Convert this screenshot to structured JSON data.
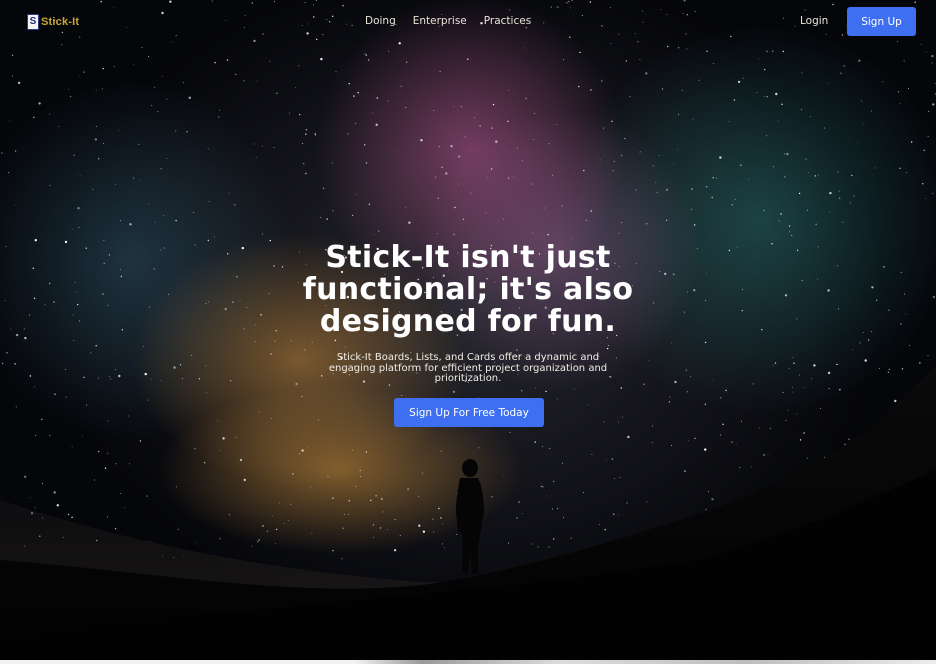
{
  "brand": {
    "logo_glyph": "S",
    "name": "Stick-It",
    "color": "#c9a636"
  },
  "nav": {
    "links": [
      "Doing",
      "Enterprise",
      "Practices"
    ],
    "login_label": "Login",
    "signup_label": "Sign Up"
  },
  "hero": {
    "headline": "Stick-It isn't just functional; it's also designed for fun.",
    "subtitle": "Stick-It Boards, Lists, and Cards offer a dynamic and engaging platform for efficient project organization and prioritization.",
    "cta_label": "Sign Up For Free Today",
    "background": "night sky milky way with silhouette of person standing on hill"
  },
  "colors": {
    "accent": "#3d6ff0",
    "text": "#ffffff"
  }
}
